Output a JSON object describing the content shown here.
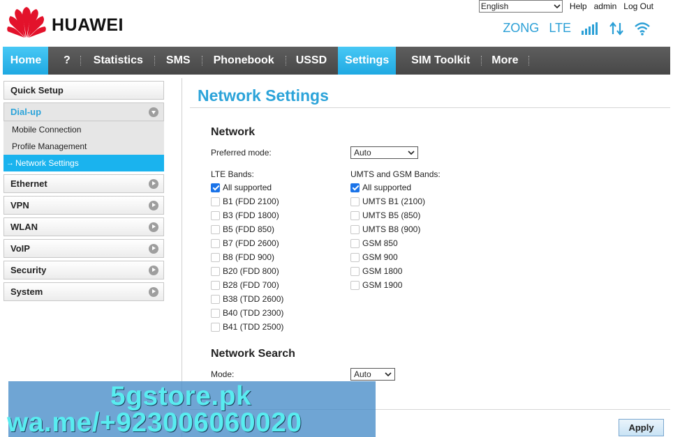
{
  "header": {
    "brand": "HUAWEI",
    "language": "English",
    "links": {
      "help": "Help",
      "admin": "admin",
      "logout": "Log Out"
    },
    "status": {
      "operator": "ZONG",
      "network_type": "LTE",
      "signal_icon": "signal-bars-icon",
      "data_icon": "data-transfer-icon",
      "wifi_icon": "wifi-icon"
    }
  },
  "nav": {
    "items": [
      "Home",
      "?",
      "Statistics",
      "SMS",
      "Phonebook",
      "USSD",
      "Settings",
      "SIM Toolkit",
      "More"
    ],
    "active": [
      "Home",
      "Settings"
    ]
  },
  "sidebar": {
    "quick_setup": "Quick Setup",
    "dialup": "Dial-up",
    "dialup_items": [
      "Mobile Connection",
      "Profile Management",
      "Network Settings"
    ],
    "active_item_arrow": "→",
    "sections": [
      "Ethernet",
      "VPN",
      "WLAN",
      "VoIP",
      "Security",
      "System"
    ]
  },
  "content": {
    "title": "Network Settings",
    "network_heading": "Network",
    "preferred_mode_label": "Preferred mode:",
    "preferred_mode_value": "Auto",
    "lte_bands_label": "LTE Bands:",
    "lte_bands": [
      {
        "label": "All supported",
        "checked": true
      },
      {
        "label": "B1 (FDD 2100)",
        "checked": false
      },
      {
        "label": "B3 (FDD 1800)",
        "checked": false
      },
      {
        "label": "B5 (FDD 850)",
        "checked": false
      },
      {
        "label": "B7 (FDD 2600)",
        "checked": false
      },
      {
        "label": "B8 (FDD 900)",
        "checked": false
      },
      {
        "label": "B20 (FDD 800)",
        "checked": false
      },
      {
        "label": "B28 (FDD 700)",
        "checked": false
      },
      {
        "label": "B38 (TDD 2600)",
        "checked": false
      },
      {
        "label": "B40 (TDD 2300)",
        "checked": false
      },
      {
        "label": "B41 (TDD 2500)",
        "checked": false
      }
    ],
    "umts_bands_label": "UMTS and GSM Bands:",
    "umts_bands": [
      {
        "label": "All supported",
        "checked": true
      },
      {
        "label": "UMTS B1 (2100)",
        "checked": false
      },
      {
        "label": "UMTS B5 (850)",
        "checked": false
      },
      {
        "label": "UMTS B8 (900)",
        "checked": false
      },
      {
        "label": "GSM 850",
        "checked": false
      },
      {
        "label": "GSM 900",
        "checked": false
      },
      {
        "label": "GSM 1800",
        "checked": false
      },
      {
        "label": "GSM 1900",
        "checked": false
      }
    ],
    "search_heading": "Network Search",
    "search_mode_label": "Mode:",
    "search_mode_value": "Auto",
    "apply_label": "Apply"
  },
  "watermark": {
    "line1": "5gstore.pk",
    "line2": "wa.me/+923006060020"
  },
  "colors": {
    "accent": "#2ba3d9",
    "nav_bg": "#4f4f4f",
    "nav_active": "#1fa9e2",
    "brand_red": "#e3122b"
  }
}
